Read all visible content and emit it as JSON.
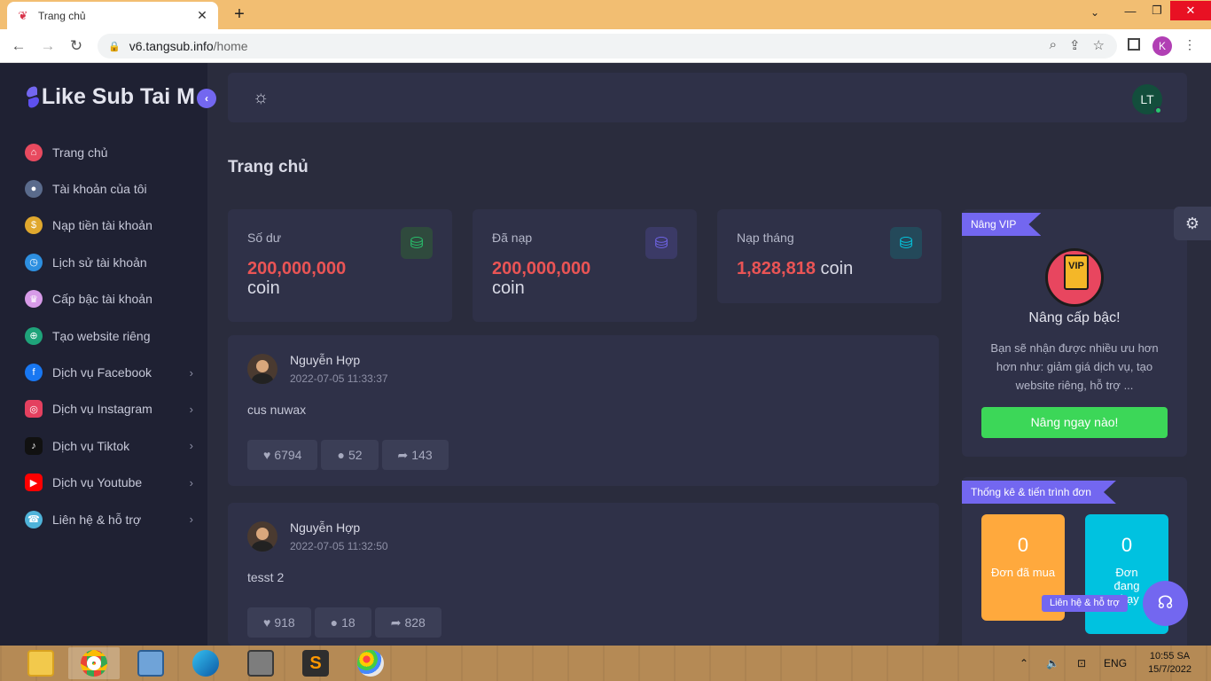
{
  "browser": {
    "tab_title": "Trang chủ",
    "url_host": "v6.tangsub.info",
    "url_path": "/home",
    "profile_initial": "K"
  },
  "sidebar": {
    "logo_text": "Like Sub Tai M",
    "items": [
      {
        "label": "Trang chủ",
        "icon": "home-icon",
        "color": "#e84a5f",
        "has_sub": false
      },
      {
        "label": "Tài khoản của tôi",
        "icon": "user-icon",
        "color": "#5a6b8c",
        "has_sub": false
      },
      {
        "label": "Nạp tiền tài khoản",
        "icon": "coins-icon",
        "color": "#e0a82e",
        "has_sub": false
      },
      {
        "label": "Lịch sử tài khoản",
        "icon": "clock-icon",
        "color": "#2d8fe0",
        "has_sub": false
      },
      {
        "label": "Cấp bậc tài khoản",
        "icon": "rank-icon",
        "color": "#d79be8",
        "has_sub": false
      },
      {
        "label": "Tạo website riêng",
        "icon": "globe-icon",
        "color": "#1fa37a",
        "has_sub": false
      },
      {
        "label": "Dịch vụ Facebook",
        "icon": "facebook-icon",
        "color": "#1877f2",
        "has_sub": true
      },
      {
        "label": "Dịch vụ Instagram",
        "icon": "instagram-icon",
        "color": "#e4405f",
        "has_sub": true
      },
      {
        "label": "Dịch vụ Tiktok",
        "icon": "tiktok-icon",
        "color": "#111111",
        "has_sub": true
      },
      {
        "label": "Dịch vụ Youtube",
        "icon": "youtube-icon",
        "color": "#ff0000",
        "has_sub": true
      },
      {
        "label": "Liên hệ & hỗ trợ",
        "icon": "support-icon",
        "color": "#4fb3d9",
        "has_sub": true
      }
    ]
  },
  "header": {
    "avatar_initials": "LT"
  },
  "page": {
    "title": "Trang chủ"
  },
  "stats": [
    {
      "label": "Số dư",
      "value": "200,000,000",
      "unit": "coin",
      "color": "#28c76f"
    },
    {
      "label": "Đã nạp",
      "value": "200,000,000",
      "unit": "coin",
      "color": "#7367f0"
    },
    {
      "label": "Nạp tháng",
      "value": "1,828,818",
      "unit": "coin",
      "color": "#00cfe8"
    }
  ],
  "posts": [
    {
      "author": "Nguyễn Hợp",
      "date": "2022-07-05 11:33:37",
      "text": "cus nuwax",
      "likes": "6794",
      "comments": "52",
      "shares": "143"
    },
    {
      "author": "Nguyễn Hợp",
      "date": "2022-07-05 11:32:50",
      "text": "tesst 2",
      "likes": "918",
      "comments": "18",
      "shares": "828"
    }
  ],
  "vip": {
    "ribbon": "Nâng VIP",
    "badge_text": "VIP",
    "title": "Nâng cấp bậc!",
    "desc": "Bạn sẽ nhận được nhiều ưu hơn hơn như: giảm giá dịch vụ, tạo website riêng, hỗ trợ ...",
    "button": "Nâng ngay nào!"
  },
  "orders": {
    "ribbon": "Thống kê & tiến trình đơn",
    "bought_count": "0",
    "bought_label": "Đơn đã mua",
    "running_count": "0",
    "running_label": "Đơn đang chạy"
  },
  "support": {
    "tooltip": "Liên hệ & hỗ trợ"
  },
  "taskbar": {
    "lang": "ENG",
    "time": "10:55 SA",
    "date": "15/7/2022"
  }
}
